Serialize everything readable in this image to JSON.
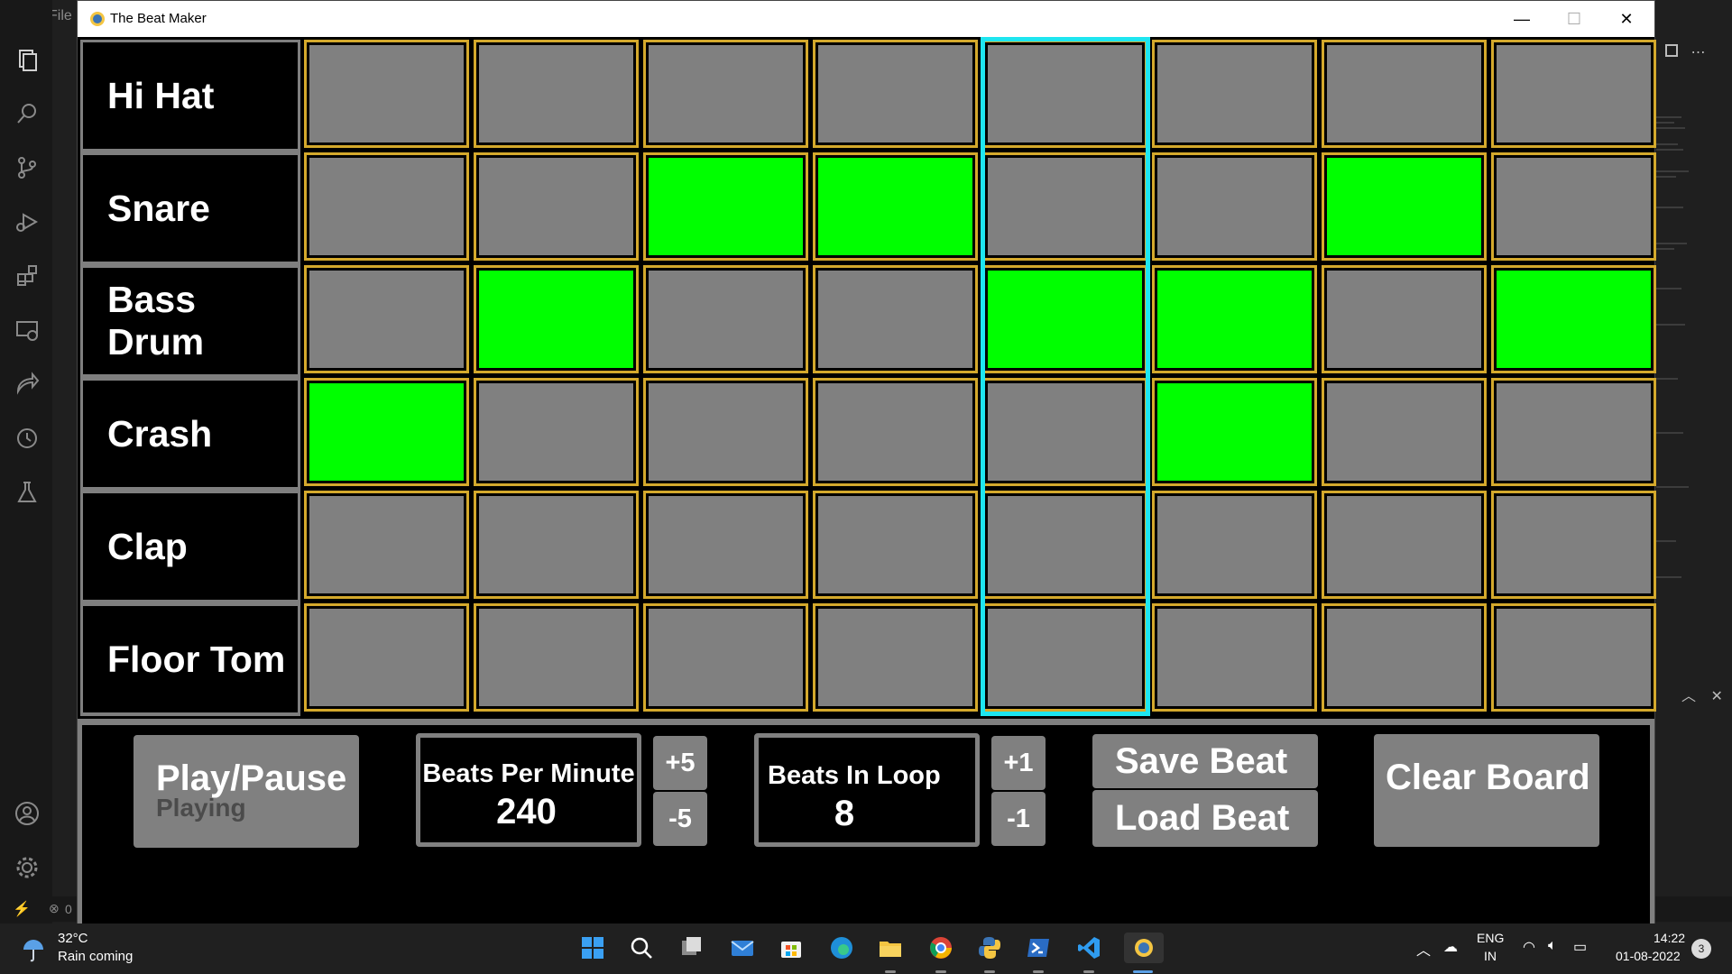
{
  "vscode": {
    "file_menu": "File",
    "status_left": "0"
  },
  "window": {
    "title": "The Beat Maker",
    "minimize_glyph": "—",
    "maximize_glyph": "☐",
    "close_glyph": "✕"
  },
  "instruments": [
    "Hi Hat",
    "Snare",
    "Bass Drum",
    "Crash",
    "Clap",
    "Floor Tom"
  ],
  "grid": {
    "beats": 8,
    "active_beat_index": 4,
    "pattern": [
      [
        0,
        0,
        0,
        0,
        0,
        0,
        0,
        0
      ],
      [
        0,
        0,
        1,
        1,
        0,
        0,
        1,
        0
      ],
      [
        0,
        1,
        0,
        0,
        1,
        1,
        0,
        1
      ],
      [
        1,
        0,
        0,
        0,
        0,
        1,
        0,
        0
      ],
      [
        0,
        0,
        0,
        0,
        0,
        0,
        0,
        0
      ],
      [
        0,
        0,
        0,
        0,
        0,
        0,
        0,
        0
      ]
    ],
    "colors": {
      "cell_off": "#808080",
      "cell_on": "#00ff00",
      "cell_border": "#d4a92c",
      "active_column": "#1ee6f0"
    }
  },
  "controls": {
    "play_pause": "Play/Pause",
    "play_status": "Playing",
    "bpm_label": "Beats Per Minute",
    "bpm_value": "240",
    "bpm_plus": "+5",
    "bpm_minus": "-5",
    "loop_label": "Beats In Loop",
    "loop_value": "8",
    "loop_plus": "+1",
    "loop_minus": "-1",
    "save_beat": "Save Beat",
    "load_beat": "Load Beat",
    "clear_board": "Clear Board"
  },
  "taskbar": {
    "weather_temp": "32°C",
    "weather_desc": "Rain coming",
    "language_line1": "ENG",
    "language_line2": "IN",
    "time": "14:22",
    "date": "01-08-2022",
    "notification_count": "3"
  }
}
